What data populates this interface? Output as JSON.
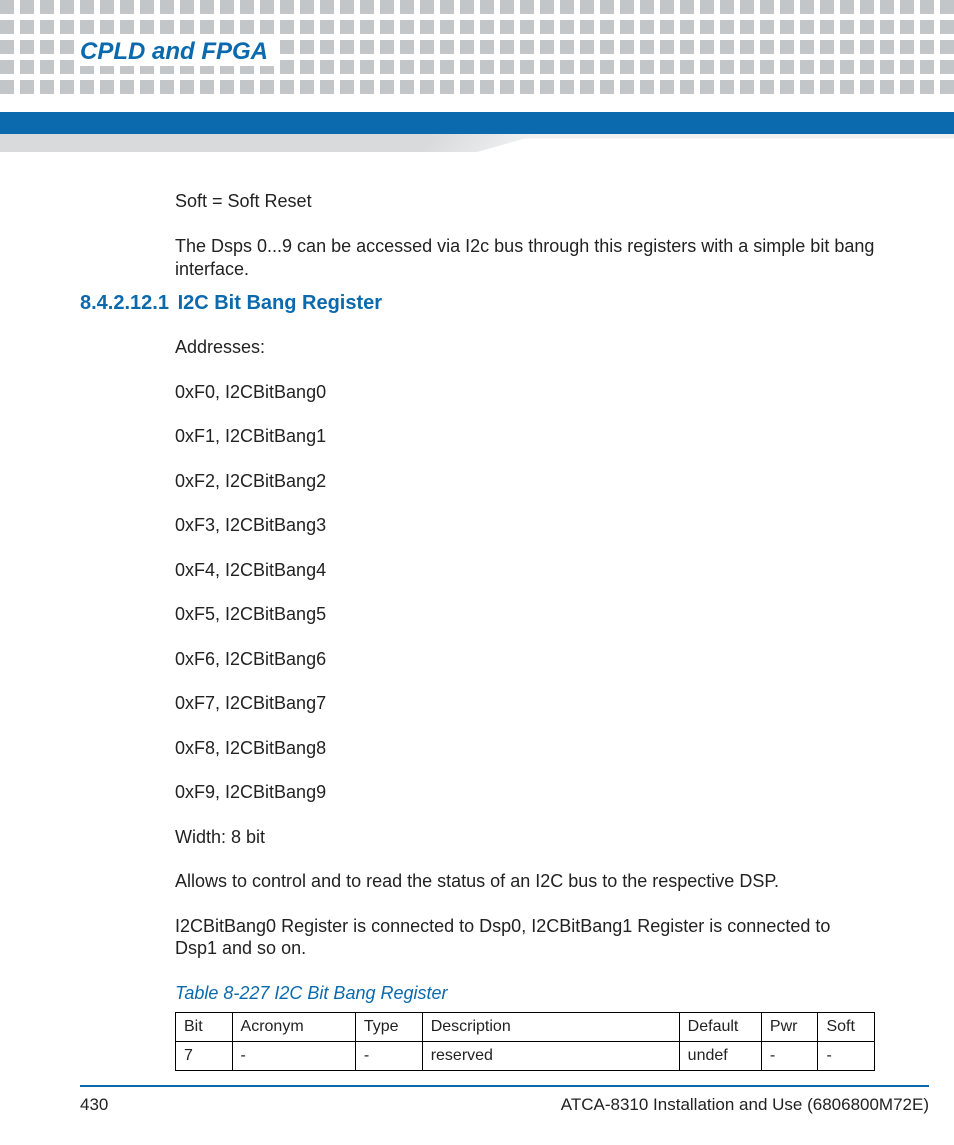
{
  "chapter_title": "CPLD and FPGA",
  "intro": {
    "line1": "Soft = Soft Reset",
    "line2": "The Dsps 0...9 can be accessed via I2c bus through this registers with a simple bit bang interface."
  },
  "section": {
    "number": "8.4.2.12.1",
    "title": "I2C Bit Bang Register"
  },
  "addresses_label": "Addresses:",
  "addresses": [
    "0xF0, I2CBitBang0",
    "0xF1, I2CBitBang1",
    "0xF2, I2CBitBang2",
    "0xF3, I2CBitBang3",
    "0xF4, I2CBitBang4",
    "0xF5, I2CBitBang5",
    "0xF6, I2CBitBang6",
    "0xF7, I2CBitBang7",
    "0xF8, I2CBitBang8",
    "0xF9, I2CBitBang9"
  ],
  "width_line": "Width: 8 bit",
  "desc1": "Allows to control and to read the status of an I2C bus to the respective DSP.",
  "desc2": "I2CBitBang0 Register is connected to Dsp0, I2CBitBang1 Register is connected to Dsp1 and so on.",
  "table": {
    "caption": "Table 8-227 I2C Bit Bang Register",
    "headers": [
      "Bit",
      "Acronym",
      "Type",
      "Description",
      "Default",
      "Pwr",
      "Soft"
    ],
    "rows": [
      [
        "7",
        "-",
        "-",
        "reserved",
        "undef",
        "-",
        "-"
      ]
    ]
  },
  "footer": {
    "page": "430",
    "doc": "ATCA-8310 Installation and Use (6806800M72E)"
  }
}
